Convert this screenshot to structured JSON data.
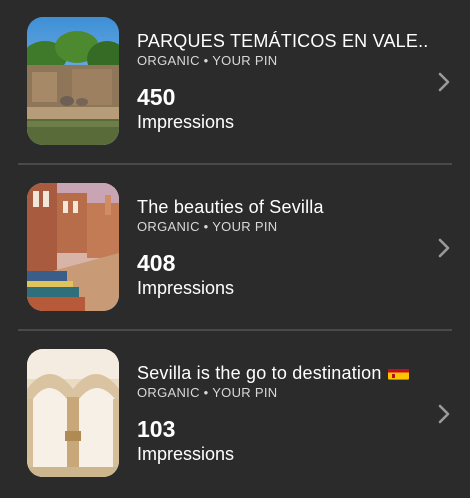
{
  "pins": [
    {
      "title": "PARQUES TEMÁTICOS EN VALE...",
      "meta": "ORGANIC • YOUR PIN",
      "count": "450",
      "count_label": "Impressions",
      "thumbnail": "zoo-elephants-photo"
    },
    {
      "title": "The beauties of Sevilla",
      "meta": "ORGANIC • YOUR PIN",
      "count": "408",
      "count_label": "Impressions",
      "thumbnail": "plaza-de-espana-photo"
    },
    {
      "title": "Sevilla is the go to destination",
      "title_emoji": "spain-flag",
      "meta": "ORGANIC • YOUR PIN",
      "count": "103",
      "count_label": "Impressions",
      "thumbnail": "alcazar-arches-photo"
    }
  ],
  "colors": {
    "background": "#2b2b2b",
    "divider": "#4a4a4a",
    "text": "#ffffff",
    "meta_text": "#d8d8d8",
    "chevron": "#9a9a9a"
  },
  "icons": {
    "row_action": "chevron-right-icon"
  }
}
